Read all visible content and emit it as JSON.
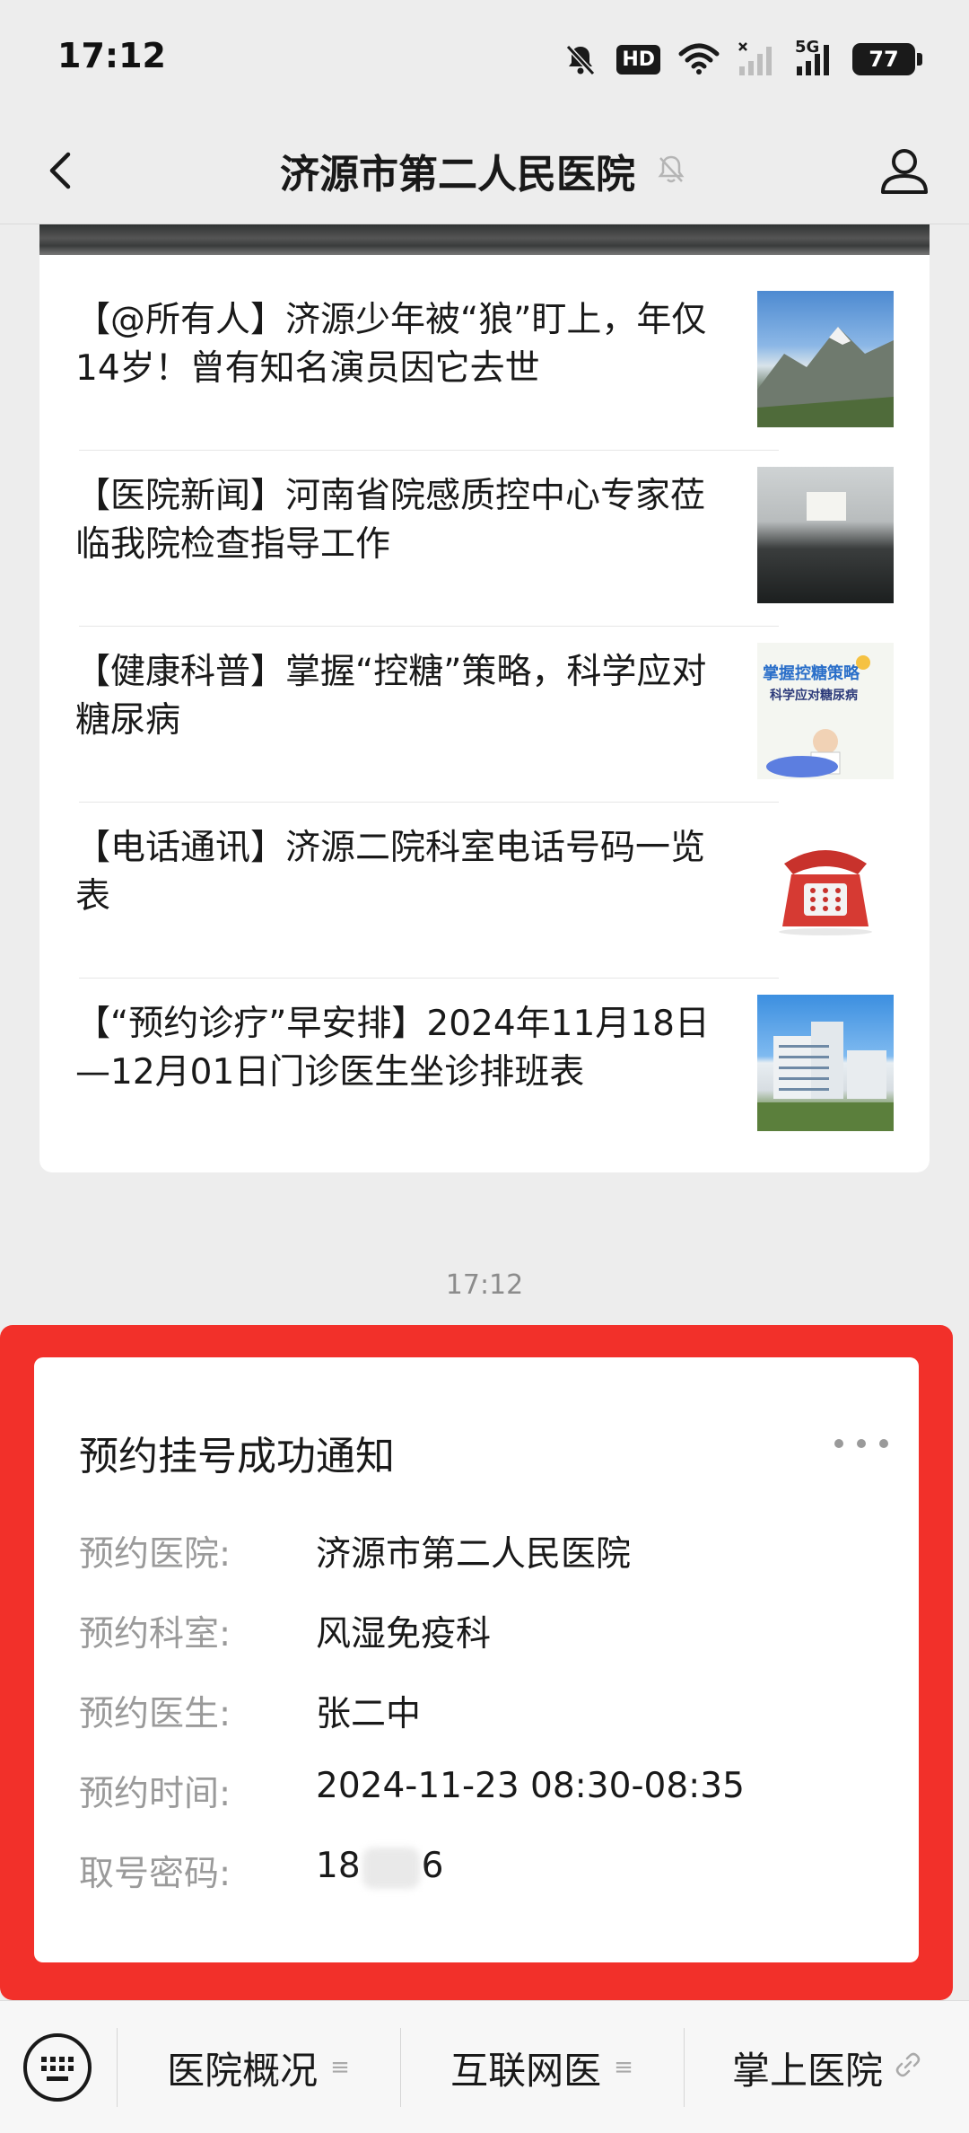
{
  "status_bar": {
    "time": "17:12",
    "hd_label": "HD",
    "network_label": "5G",
    "battery": "77",
    "icons": [
      "bell-off-icon",
      "hd-icon",
      "wifi-icon",
      "signal-icon",
      "5g-signal-icon",
      "battery-icon"
    ]
  },
  "nav": {
    "title": "济源市第二人民医院",
    "icons": [
      "back-arrow-icon",
      "bell-muted-icon",
      "profile-icon"
    ]
  },
  "articles": [
    {
      "title": "【@所有人】济源少年被“狼”盯上，年仅14岁！曾有知名演员因它去世"
    },
    {
      "title": "【医院新闻】河南省院感质控中心专家莅临我院检查指导工作"
    },
    {
      "title": "【健康科普】掌握“控糖”策略，科学应对糖尿病",
      "thumb_text_top": "掌握控糖策略",
      "thumb_text_bottom": "科学应对糖尿病"
    },
    {
      "title": "【电话通讯】济源二院科室电话号码一览表"
    },
    {
      "title": "【“预约诊疗”早安排】2024年11月18日—12月01日门诊医生坐诊排班表"
    }
  ],
  "message_time": "17:12",
  "notice": {
    "title": "预约挂号成功通知",
    "fields": [
      {
        "label": "预约医院:",
        "value": "济源市第二人民医院"
      },
      {
        "label": "预约科室:",
        "value": "风湿免疫科"
      },
      {
        "label": "预约医生:",
        "value": "张二中"
      },
      {
        "label": "预约时间:",
        "value": "2024-11-23 08:30-08:35"
      },
      {
        "label": "取号密码:",
        "value_start": "18",
        "value_end": "6"
      }
    ]
  },
  "bottom_menu": {
    "items": [
      {
        "label": "医院概况"
      },
      {
        "label": "互联网医"
      },
      {
        "label": "掌上医院"
      }
    ],
    "icons": [
      "keyboard-icon",
      "menu-lines-icon",
      "link-icon"
    ]
  },
  "colors": {
    "highlight_frame": "#f2302a",
    "background": "#ededed"
  }
}
